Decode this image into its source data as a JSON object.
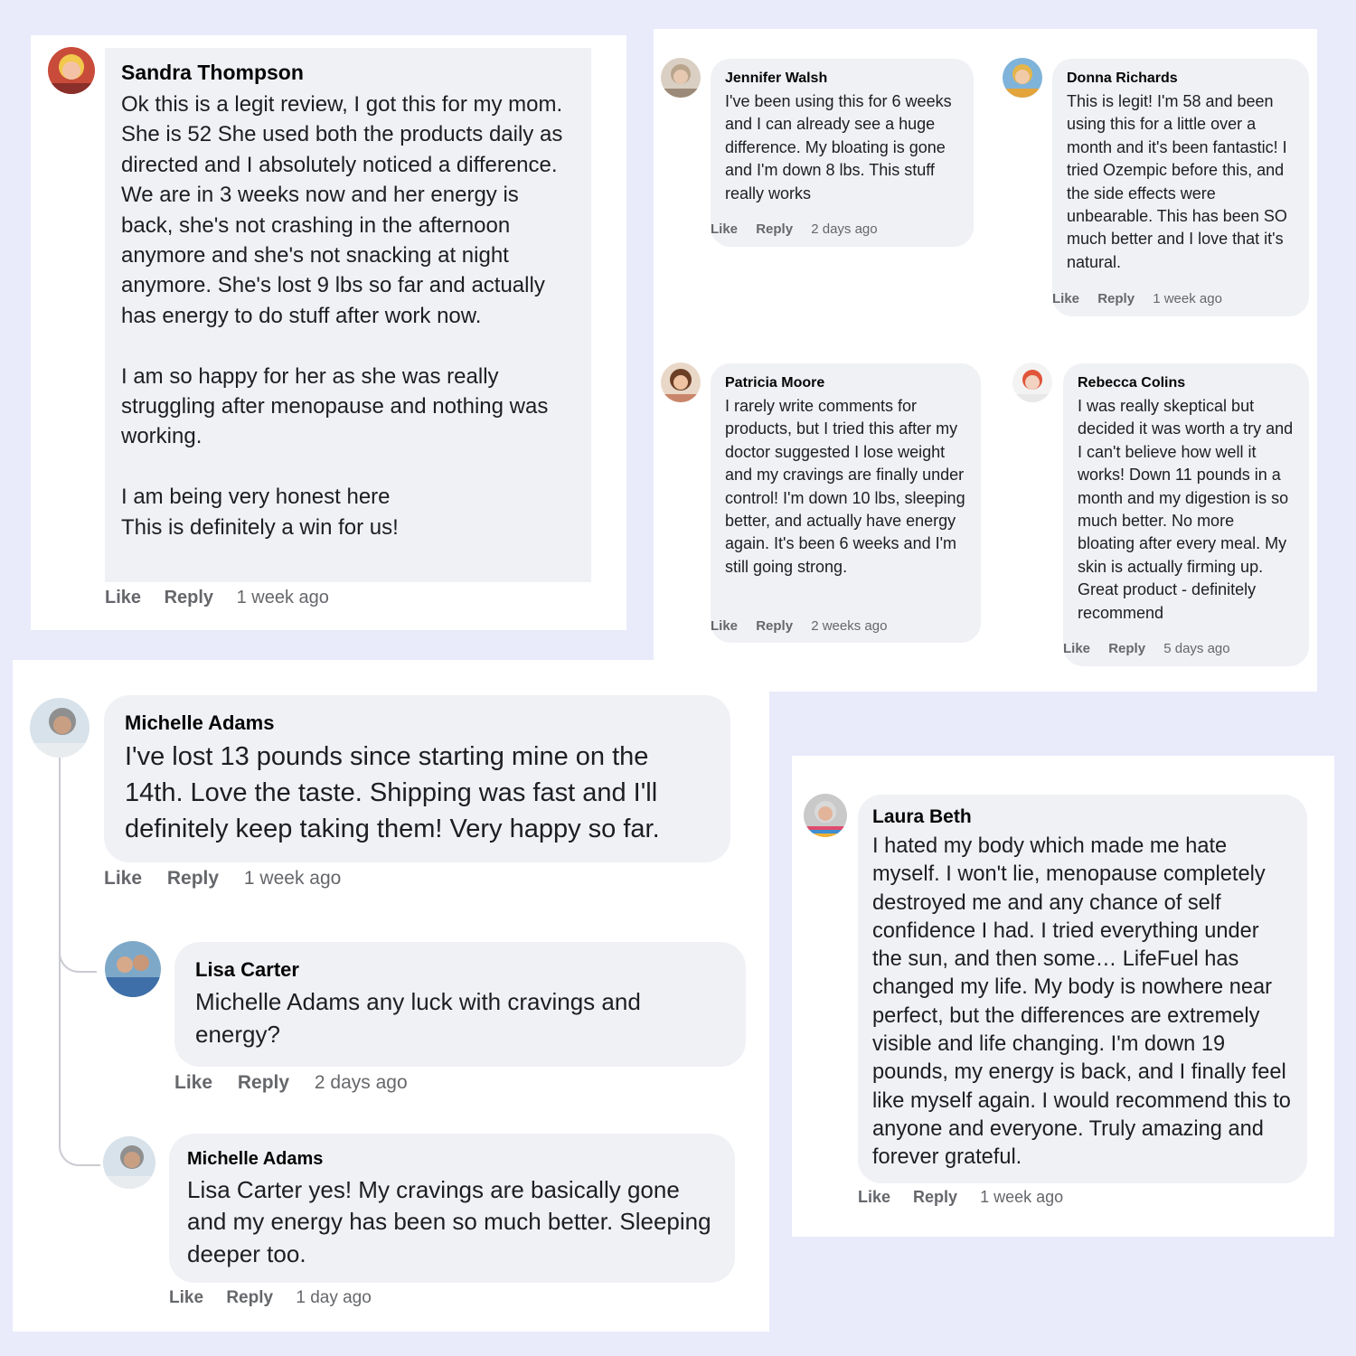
{
  "sandra": {
    "author": "Sandra Thompson",
    "body": "Ok this is a legit review, I got this for my mom. She is 52  She used both the products daily as directed and I absolutely noticed a difference.  We are in 3 weeks now and her energy is back, she's not crashing in the afternoon anymore and she's not snacking at night anymore. She's lost 9 lbs so far and actually has energy to do stuff after work now.\n\nI am so happy for her as she was really struggling after menopause and nothing was working.\n\nI am being very honest here\nThis is definitely a win for us!",
    "like": "Like",
    "reply": "Reply",
    "time": "1 week ago"
  },
  "jennifer": {
    "author": "Jennifer Walsh",
    "body": "I've been using this for 6 weeks and I can already see a huge difference. My bloating is gone and I'm down 8 lbs. This stuff really works",
    "like": "Like",
    "reply": "Reply",
    "time": "2 days ago"
  },
  "donna": {
    "author": "Donna Richards",
    "body": "This is legit! I'm 58 and been using this for a little over a month and it's been fantastic! I tried Ozempic before this, and the side effects were unbearable. This has been SO much better and I love that it's natural.",
    "like": "Like",
    "reply": "Reply",
    "time": "1 week ago"
  },
  "patricia": {
    "author": "Patricia Moore",
    "body": "I rarely write comments for products, but I tried this after my doctor suggested I lose weight and my cravings are finally under control! I'm down 10 lbs, sleeping better, and actually have energy again. It's been 6 weeks and I'm still going strong.",
    "like": "Like",
    "reply": "Reply",
    "time": "2 weeks ago"
  },
  "rebecca": {
    "author": "Rebecca Colins",
    "body": "I was really skeptical but decided it was worth a try and I can't believe how well it works! Down 11 pounds in a month and my digestion is so much better. No more bloating after every meal. My skin is actually firming up. Great product - definitely recommend",
    "like": "Like",
    "reply": "Reply",
    "time": "5 days ago"
  },
  "michelle1": {
    "author": "Michelle Adams",
    "body": "I've lost 13 pounds since starting mine on the 14th. Love the taste. Shipping was fast and I'll definitely keep taking them! Very happy so far.",
    "like": "Like",
    "reply": "Reply",
    "time": "1 week ago"
  },
  "lisa": {
    "author": "Lisa Carter",
    "body": "Michelle Adams any luck with cravings and energy?",
    "like": "Like",
    "reply": "Reply",
    "time": "2 days ago"
  },
  "michelle2": {
    "author": "Michelle Adams",
    "body": "Lisa Carter yes! My cravings are basically gone and my energy has been so much better. Sleeping deeper too.",
    "like": "Like",
    "reply": "Reply",
    "time": "1 day ago"
  },
  "laura": {
    "author": "Laura Beth",
    "body": "I hated my body which made me hate myself. I won't lie, menopause completely destroyed me and any chance of self confidence I had. I tried everything under the sun, and then some… LifeFuel has changed my life. My body is nowhere near perfect, but the differences are extremely visible and life changing. I'm down 19 pounds, my energy is back, and I finally feel like myself again. I would recommend this to anyone and everyone. Truly amazing and forever grateful.",
    "like": "Like",
    "reply": "Reply",
    "time": "1 week ago"
  },
  "icons": {
    "avatar": "user-photo-avatar",
    "thread": "reply-thread-connector"
  },
  "colors": {
    "page_background": "#e9eafa",
    "card_background": "#ffffff",
    "bubble_background": "#f0f1f5",
    "meta_text": "#65676b"
  }
}
